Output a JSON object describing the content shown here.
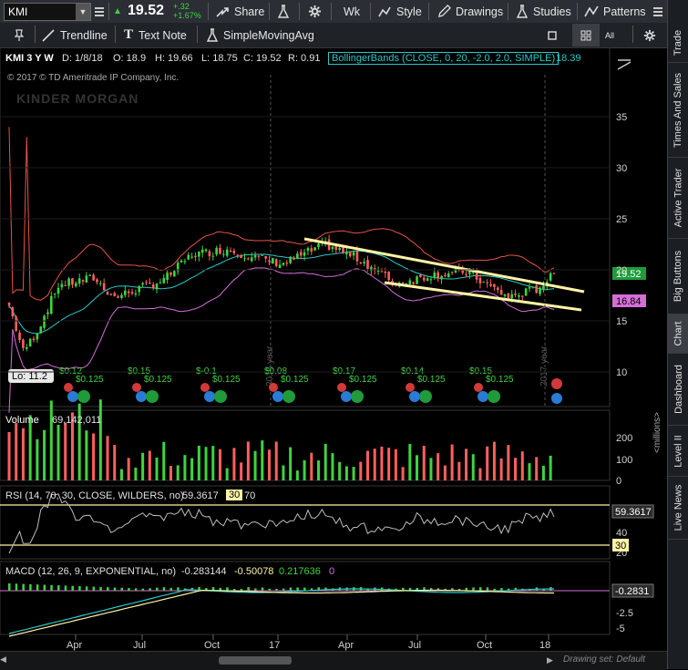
{
  "toolbar": {
    "symbol": "KMI",
    "price": "19.52",
    "change_abs": "+.32",
    "change_pct": "+1.67%",
    "share": "Share",
    "timeframe": "Wk",
    "style": "Style",
    "drawings": "Drawings",
    "studies": "Studies",
    "patterns": "Patterns"
  },
  "drawtools": {
    "trendline": "Trendline",
    "textnote": "Text Note",
    "sma": "SimpleMovingAvg",
    "all": "All"
  },
  "header": {
    "period": "KMI 3 Y W",
    "date": "D: 1/8/18",
    "open": "O: 18.9",
    "high": "H: 19.66",
    "low": "L: 18.75",
    "close": "C: 19.52",
    "range": "R: 0.91",
    "bb_label": "BollingerBands (CLOSE, 0, 20, -2.0, 2.0, SIMPLE)",
    "bb_value": "18.39",
    "copyright": "© 2017 © TD Ameritrade IP Company, Inc.",
    "watermark": "KINDER MORGAN"
  },
  "price_axis": [
    "35",
    "30",
    "25",
    "20",
    "15",
    "10"
  ],
  "price_tags": {
    "last": "19.52",
    "lower_band": "16.84",
    "low_bubble": "Lo: 11.2"
  },
  "year_labels": [
    "2016 year",
    "2017 year"
  ],
  "dividends": [
    "$0.12",
    "$0.125",
    "$0.15",
    "$0.125",
    "$-0.1",
    "$0.125",
    "$0.08",
    "$0.125",
    "$0.17",
    "$0.125",
    "$0.14",
    "$0.125",
    "$0.15",
    "$0.125"
  ],
  "volume": {
    "label": "Volume",
    "value": "69,142,011",
    "axis": [
      "200",
      "100",
      "0"
    ],
    "unit": "<millions>"
  },
  "rsi": {
    "label": "RSI (14, 70, 30, CLOSE, WILDERS, no)",
    "value": "59.3617",
    "ob": "30",
    "os": "70",
    "axis": [
      "60",
      "40",
      "20"
    ],
    "tag": "59.3617",
    "tag30": "30"
  },
  "macd": {
    "label": "MACD (12, 26, 9, EXPONENTIAL, no)",
    "v1": "-0.283144",
    "v2": "-0.50078",
    "v3": "0.217636",
    "v4": "0",
    "axis": [
      "0",
      "-2.5",
      "-5"
    ],
    "tag": "-0.2831"
  },
  "time_axis": [
    "Apr",
    "Jul",
    "Oct",
    "17",
    "Apr",
    "Jul",
    "Oct",
    "18"
  ],
  "footer": {
    "drawing_set": "Drawing set: Default"
  },
  "side_tabs": [
    "Trade",
    "Times And Sales",
    "Active Trader",
    "Big Buttons",
    "Chart",
    "Dashboard",
    "Level II",
    "Live News"
  ],
  "colors": {
    "bg": "#000000",
    "up": "#3fd33f",
    "down": "#ff5f5f",
    "bb_upper": "#e8514a",
    "bb_mid": "#29c9c9",
    "bb_lower": "#d66ed8",
    "trend": "#fff3a6",
    "accent": "#4aa6ff"
  }
}
